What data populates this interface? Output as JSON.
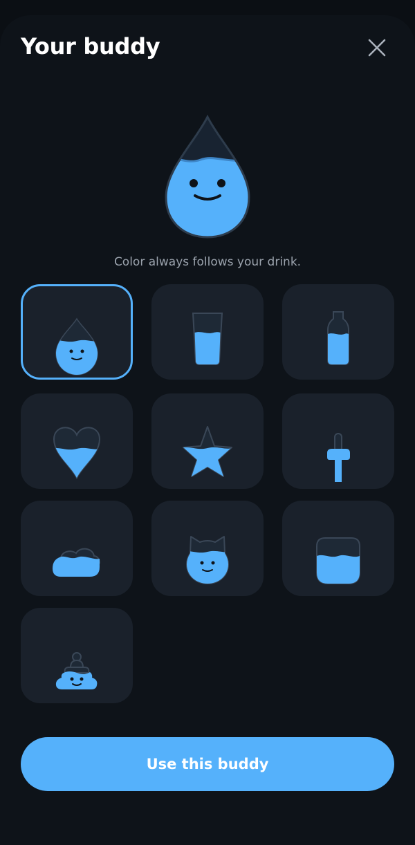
{
  "header": {
    "title": "Your buddy",
    "close_icon": "close-icon"
  },
  "preview": {
    "icon": "water-drop-buddy-icon",
    "caption": "Color always follows your drink."
  },
  "buddies": [
    {
      "icon": "drop-icon",
      "selected": true
    },
    {
      "icon": "glass-icon",
      "selected": false
    },
    {
      "icon": "bottle-icon",
      "selected": false
    },
    {
      "icon": "heart-icon",
      "selected": false
    },
    {
      "icon": "star-icon",
      "selected": false
    },
    {
      "icon": "faucet-icon",
      "selected": false
    },
    {
      "icon": "cloud-icon",
      "selected": false
    },
    {
      "icon": "cat-icon",
      "selected": false
    },
    {
      "icon": "jar-icon",
      "selected": false
    },
    {
      "icon": "poop-icon",
      "selected": false
    }
  ],
  "footer": {
    "button_label": "Use this buddy"
  },
  "colors": {
    "accent": "#55b1fb",
    "tile": "#1a212b",
    "background": "#0e1319"
  }
}
